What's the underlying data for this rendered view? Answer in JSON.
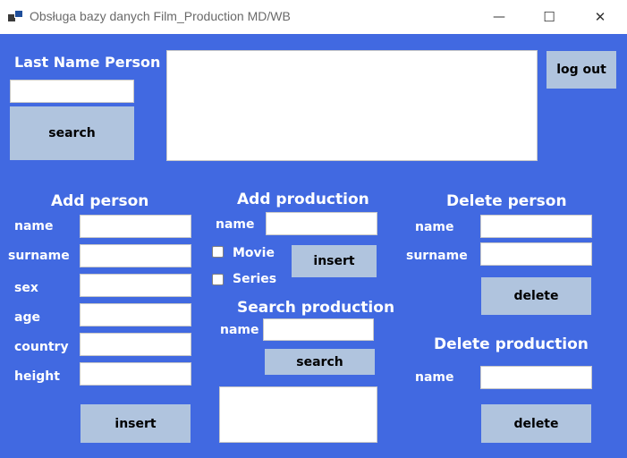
{
  "window": {
    "title": "Obsługa bazy danych Film_Production MD/WB",
    "minimize": "—",
    "maximize": "☐",
    "close": "✕"
  },
  "top": {
    "last_name_label": "Last Name Person",
    "search_button": "search",
    "logout_button": "log out"
  },
  "add_person": {
    "title": "Add person",
    "name": "name",
    "surname": "surname",
    "sex": "sex",
    "age": "age",
    "country": "country",
    "height": "height",
    "insert_button": "insert"
  },
  "add_production": {
    "title": "Add production",
    "name": "name",
    "movie": "Movie",
    "series": "Series",
    "insert_button": "insert"
  },
  "search_production": {
    "title": "Search production",
    "name": "name",
    "search_button": "search"
  },
  "delete_person": {
    "title": "Delete person",
    "name": "name",
    "surname": "surname",
    "delete_button": "delete"
  },
  "delete_production": {
    "title": "Delete production",
    "name": "name",
    "delete_button": "delete"
  },
  "colors": {
    "background": "#4169e1",
    "button": "#b0c4de"
  }
}
